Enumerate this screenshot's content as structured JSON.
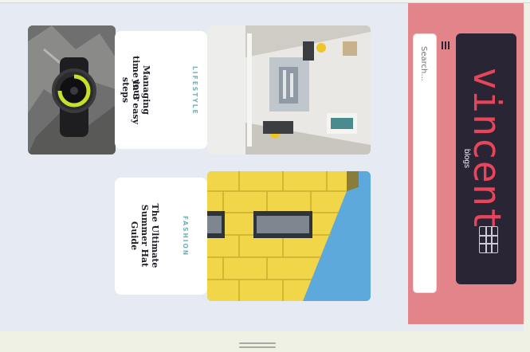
{
  "header": {
    "logo_text": "vincent",
    "logo_subtitle": "blogs",
    "search_placeholder": "Search...",
    "accent_color": "#e8455a",
    "header_bg": "#e3838a"
  },
  "posts": [
    {
      "category": "LIFESTYLE",
      "title_lines": [
        "Managing your",
        "time in 3 easy",
        "steps"
      ]
    },
    {
      "category": "FASHION",
      "title_lines": [
        "The Ultimate",
        "Summer Hat",
        "Guide"
      ]
    }
  ],
  "icons": {
    "menu": "hamburger-icon",
    "logo_mark": "grid-icon"
  }
}
